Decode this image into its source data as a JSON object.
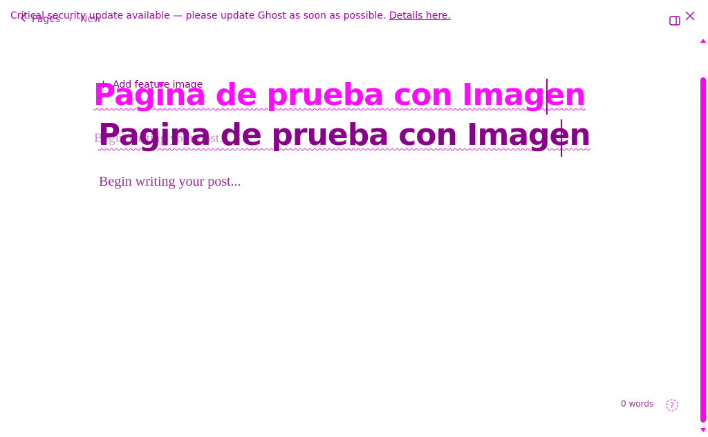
{
  "alert": {
    "message": "Critical security update available — please update Ghost as soon as possible.",
    "link_label": "Details here."
  },
  "header": {
    "breadcrumb_parent": "Pages",
    "status": "New"
  },
  "editor": {
    "feature_image_label": "Add feature image",
    "title": "Pagina de prueba con Imagen",
    "title_echo": "Pagina de prueba con Imagen",
    "ghost_placeholder": "Begin writing your post...",
    "body_placeholder": "Begin writing your post..."
  },
  "footer": {
    "word_count": "0 words"
  },
  "colors": {
    "accent": "#ff00ff",
    "primary": "#8a008a"
  },
  "icons": {
    "back": "chevron-left-icon",
    "sidebar": "sidebar-toggle-icon",
    "close": "close-icon",
    "help": "help-icon",
    "add": "plus-icon"
  }
}
